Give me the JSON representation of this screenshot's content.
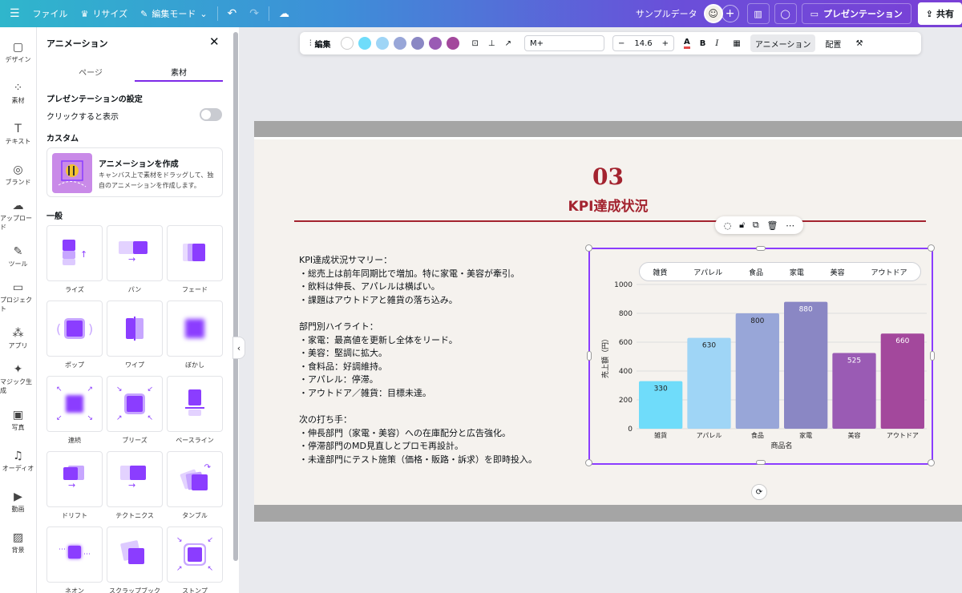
{
  "topbar": {
    "file": "ファイル",
    "resize": "リサイズ",
    "edit_mode": "編集モード",
    "sample_data": "サンプルデータ",
    "present": "プレゼンテーション",
    "share": "共有"
  },
  "leftnav": [
    {
      "label": "デザイン",
      "icon": "design-icon"
    },
    {
      "label": "素材",
      "icon": "elements-icon"
    },
    {
      "label": "テキスト",
      "icon": "text-icon"
    },
    {
      "label": "ブランド",
      "icon": "brand-icon"
    },
    {
      "label": "アップロード",
      "icon": "upload-icon"
    },
    {
      "label": "ツール",
      "icon": "tools-icon"
    },
    {
      "label": "プロジェクト",
      "icon": "folder-icon"
    },
    {
      "label": "アプリ",
      "icon": "apps-icon"
    },
    {
      "label": "マジック生成",
      "icon": "magic-icon"
    },
    {
      "label": "写真",
      "icon": "photo-icon"
    },
    {
      "label": "オーディオ",
      "icon": "audio-icon"
    },
    {
      "label": "動画",
      "icon": "video-icon"
    },
    {
      "label": "背景",
      "icon": "background-icon"
    }
  ],
  "panel": {
    "title": "アニメーション",
    "tabs": [
      "ページ",
      "素材"
    ],
    "presentation_settings": "プレゼンテーションの設定",
    "click_to_show": "クリックすると表示",
    "custom": "カスタム",
    "create_title": "アニメーションを作成",
    "create_desc": "キャンバス上で素材をドラッグして、独自のアニメーションを作成します。",
    "general": "一般",
    "animations": [
      "ライズ",
      "パン",
      "フェード",
      "ポップ",
      "ワイプ",
      "ぼかし",
      "連続",
      "ブリーズ",
      "ベースライン",
      "ドリフト",
      "テクトニクス",
      "タンブル",
      "ネオン",
      "スクラップブック",
      "ストンプ"
    ]
  },
  "canvas_toolbar": {
    "edit": "編集",
    "colors": [
      "#ffffff",
      "#6fdcfa",
      "#9fd5f6",
      "#98a6d8",
      "#8a87c4",
      "#9a5bb4",
      "#a3489c"
    ],
    "font": "M+",
    "size": "14.6",
    "animation": "アニメーション",
    "position": "配置"
  },
  "slide": {
    "number": "03",
    "title": "KPI達成状況",
    "summary_heading": "KPI達成状況サマリー：",
    "summary": [
      "・総売上は前年同期比で増加。特に家電・美容が牽引。",
      "・飲料は伸長、アパレルは横ばい。",
      "・課題はアウトドアと雑貨の落ち込み。"
    ],
    "highlight_heading": "部門別ハイライト：",
    "highlights": [
      "・家電：最高値を更新し全体をリード。",
      "・美容：堅調に拡大。",
      "・食料品：好調維持。",
      "・アパレル：停滞。",
      "・アウトドア／雑貨：目標未達。"
    ],
    "next_heading": "次の打ち手：",
    "next": [
      "・伸長部門（家電・美容）への在庫配分と広告強化。",
      "・停滞部門のMD見直しとプロモ再設計。",
      "・未達部門にテスト施策（価格・販路・訴求）を即時投入。"
    ]
  },
  "chart_data": {
    "type": "bar",
    "categories": [
      "雑貨",
      "アパレル",
      "食品",
      "家電",
      "美容",
      "アウトドア"
    ],
    "values": [
      330,
      630,
      800,
      880,
      525,
      660
    ],
    "colors": [
      "#6fdcfa",
      "#9fd5f6",
      "#98a6d8",
      "#8a87c4",
      "#9a5bb4",
      "#a3489c"
    ],
    "xlabel": "商品名",
    "ylabel": "売上額（円）",
    "ylim": [
      0,
      1000
    ],
    "yticks": [
      0,
      200,
      400,
      600,
      800,
      1000
    ],
    "legend": "top",
    "grid": true
  }
}
